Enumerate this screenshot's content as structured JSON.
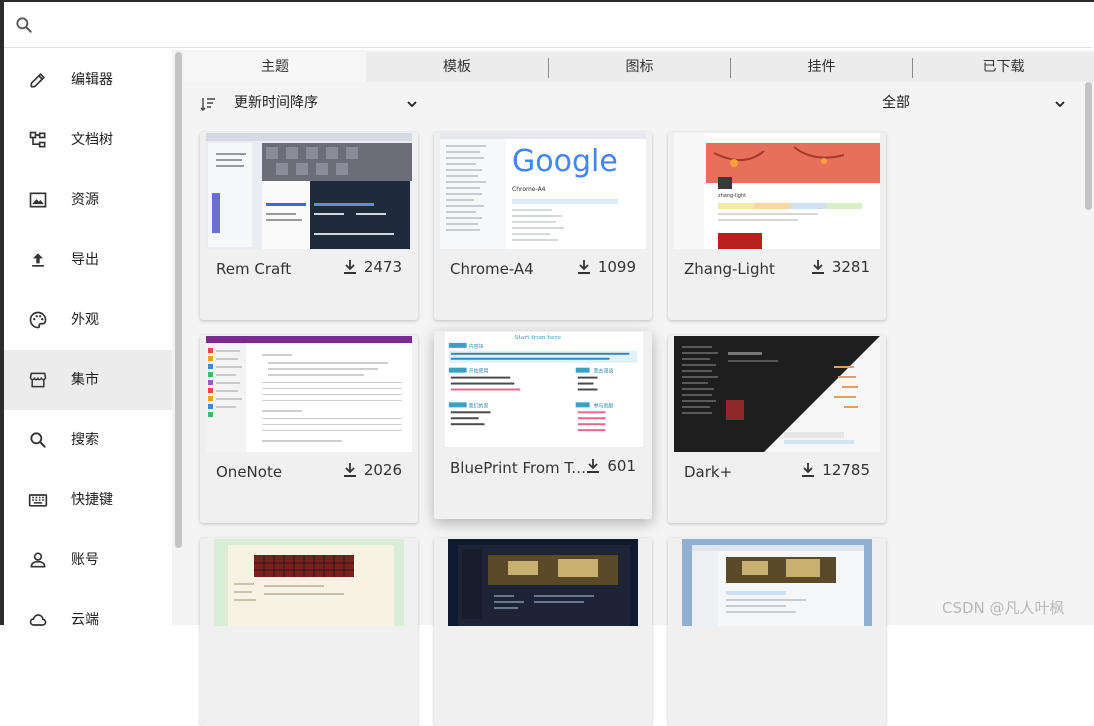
{
  "search": {
    "placeholder": ""
  },
  "sidebar": {
    "items": [
      {
        "label": "编辑器",
        "icon": "pencil-icon"
      },
      {
        "label": "文档树",
        "icon": "tree-icon"
      },
      {
        "label": "资源",
        "icon": "image-icon"
      },
      {
        "label": "导出",
        "icon": "upload-icon"
      },
      {
        "label": "外观",
        "icon": "palette-icon"
      },
      {
        "label": "集市",
        "icon": "store-icon"
      },
      {
        "label": "搜索",
        "icon": "search-icon"
      },
      {
        "label": "快捷键",
        "icon": "keyboard-icon"
      },
      {
        "label": "账号",
        "icon": "user-icon"
      },
      {
        "label": "云端",
        "icon": "cloud-icon"
      }
    ],
    "active_index": 5
  },
  "tabs": [
    {
      "label": "主题",
      "active": true
    },
    {
      "label": "模板",
      "active": false
    },
    {
      "label": "图标",
      "active": false
    },
    {
      "label": "挂件",
      "active": false
    },
    {
      "label": "已下载",
      "active": false
    }
  ],
  "sort": {
    "label": "更新时间降序"
  },
  "filter": {
    "label": "全部"
  },
  "cards": [
    {
      "name": "Rem Craft",
      "downloads": "2473"
    },
    {
      "name": "Chrome-A4",
      "downloads": "1099"
    },
    {
      "name": "Zhang-Light",
      "downloads": "3281"
    },
    {
      "name": "OneNote",
      "downloads": "2026"
    },
    {
      "name": "BluePrint From Ts...",
      "downloads": "601"
    },
    {
      "name": "Dark+",
      "downloads": "12785"
    }
  ],
  "thumb_text": {
    "google": "Google",
    "chrome_title": "Chrome-A4",
    "zhang_title": "zhang-light",
    "blueprint_header": "Start from here",
    "blueprint_s1": "内容块",
    "blueprint_s2": "开始使用",
    "blueprint_s3": "我们的家",
    "blueprint_s4": "我去漫谈",
    "blueprint_s5": "参与贡献"
  },
  "watermark": "CSDN @凡人叶枫",
  "colors": {
    "accent_active": "#ececec",
    "main_bg": "#f4f4f4"
  }
}
